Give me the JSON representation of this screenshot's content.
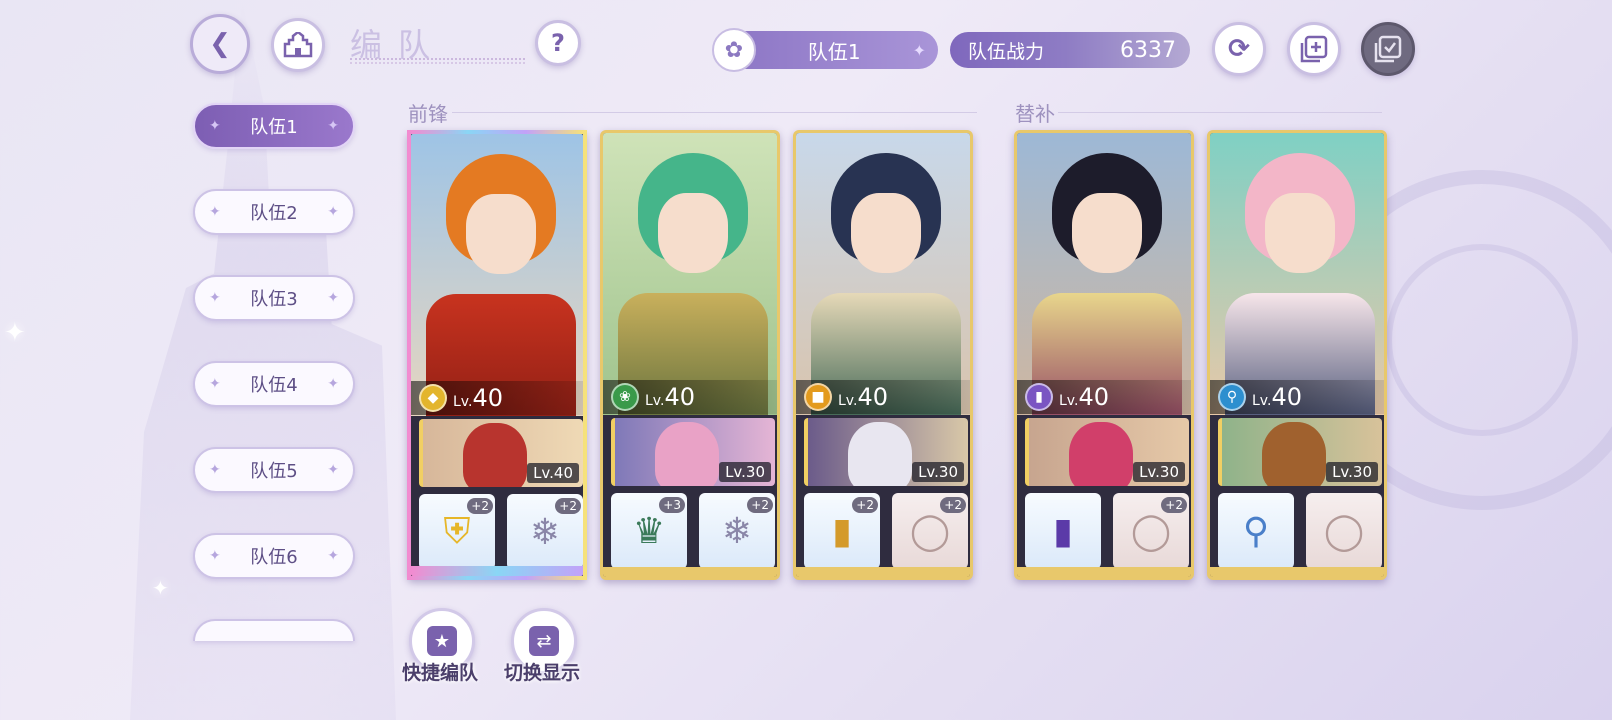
{
  "header": {
    "title": "编队",
    "team_name": "队伍1",
    "power_label": "队伍战力",
    "power_value": "6337",
    "help_label": "?"
  },
  "icons": {
    "back": "back-arrow-icon",
    "home": "castle-icon",
    "help": "question-icon",
    "feather": "feather-icon",
    "refresh": "refresh-icon",
    "add": "add-copy-icon",
    "confirm": "confirm-check-icon"
  },
  "sidebar": {
    "tabs": [
      {
        "label": "队伍1",
        "active": true
      },
      {
        "label": "队伍2",
        "active": false
      },
      {
        "label": "队伍3",
        "active": false
      },
      {
        "label": "队伍4",
        "active": false
      },
      {
        "label": "队伍5",
        "active": false
      },
      {
        "label": "队伍6",
        "active": false
      }
    ]
  },
  "sections": {
    "front_label": "前锋",
    "sub_label": "替补"
  },
  "cards": [
    {
      "level_prefix": "Lv.",
      "level": "40",
      "class_color": "#e3b52d",
      "support_level": "Lv.40",
      "equip1_plus": "+2",
      "equip2_plus": "+2",
      "equip1_icon": "shield-icon",
      "equip2_icon": "earring-icon"
    },
    {
      "level_prefix": "Lv.",
      "level": "40",
      "class_color": "#3a9a4a",
      "support_level": "Lv.30",
      "equip1_plus": "+3",
      "equip2_plus": "+2",
      "equip1_icon": "boots-icon",
      "equip2_icon": "earring-icon"
    },
    {
      "level_prefix": "Lv.",
      "level": "40",
      "class_color": "#e39a1d",
      "support_level": "Lv.30",
      "equip1_plus": "+2",
      "equip2_plus": "+2",
      "equip1_icon": "book-icon",
      "equip2_icon": "ring-icon"
    },
    {
      "level_prefix": "Lv.",
      "level": "40",
      "class_color": "#7a55c2",
      "support_level": "Lv.30",
      "equip1_plus": "",
      "equip2_plus": "+2",
      "equip1_icon": "spellbook-icon",
      "equip2_icon": "ring-icon"
    },
    {
      "level_prefix": "Lv.",
      "level": "40",
      "class_color": "#2d8fcf",
      "support_level": "Lv.30",
      "equip1_plus": "",
      "equip2_plus": "",
      "equip1_icon": "magnifier-icon",
      "equip2_icon": "ring-icon"
    }
  ],
  "actions": {
    "quick_label": "快捷编队",
    "switch_label": "切换显示"
  }
}
